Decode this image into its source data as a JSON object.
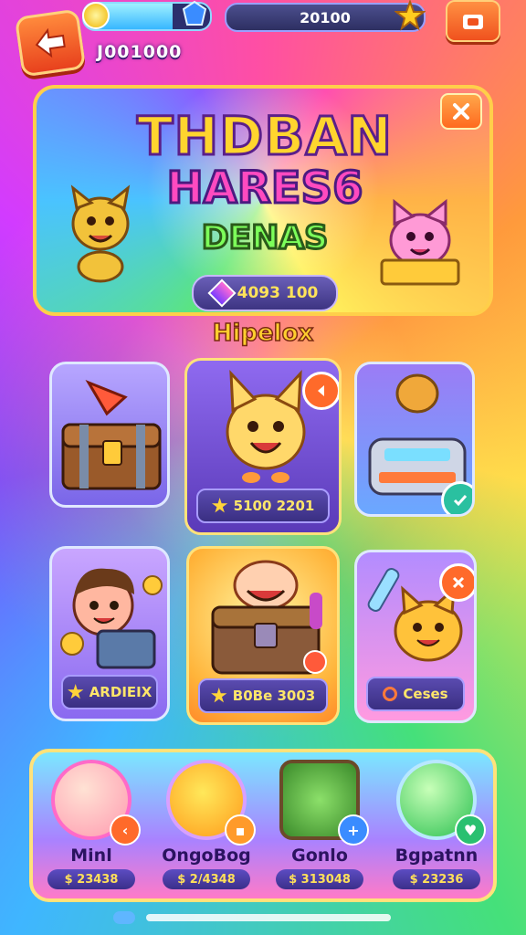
{
  "header": {
    "account_id": "J001000",
    "currency_value": "20100",
    "xp_progress": 0.7
  },
  "banner": {
    "title_line1": "THDBAN",
    "title_line2": "HARES6",
    "title_line3": "DENAS",
    "price": "4093 100"
  },
  "section": {
    "title": "Hipelox"
  },
  "cards": [
    {
      "name": "treasure-chest-card",
      "label": ""
    },
    {
      "name": "cat-card",
      "label": "5100 2201"
    },
    {
      "name": "toaster-card",
      "label": ""
    },
    {
      "name": "boy-card",
      "label": "ARDIEIX"
    },
    {
      "name": "golden-chest-card",
      "label": "B0Be 3003"
    },
    {
      "name": "potion-cat-card",
      "label": "Ceses"
    }
  ],
  "dock": {
    "items": [
      {
        "name": "Minl",
        "price": "$ 23438"
      },
      {
        "name": "OngoBog",
        "price": "$ 2/4348"
      },
      {
        "name": "Gonlo",
        "price": "$ 313048"
      },
      {
        "name": "Bgpatnn",
        "price": "$ 23236"
      }
    ]
  },
  "colors": {
    "accent_orange": "#ff6a1f",
    "gold": "#ffd43a",
    "panel_purple": "#3a2f82"
  }
}
